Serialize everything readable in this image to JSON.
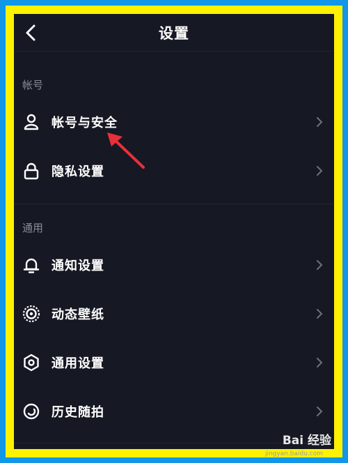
{
  "header": {
    "title": "设置"
  },
  "sections": [
    {
      "label": "帐号",
      "items": [
        {
          "label": "帐号与安全",
          "icon": "user-icon"
        },
        {
          "label": "隐私设置",
          "icon": "lock-icon"
        }
      ]
    },
    {
      "label": "通用",
      "items": [
        {
          "label": "通知设置",
          "icon": "bell-icon"
        },
        {
          "label": "动态壁纸",
          "icon": "wallpaper-icon"
        },
        {
          "label": "通用设置",
          "icon": "gear-icon"
        },
        {
          "label": "历史随拍",
          "icon": "history-icon"
        }
      ]
    }
  ],
  "watermark": {
    "text": "Bai 经验",
    "url": "jingyan.baidu.com"
  },
  "colors": {
    "background": "#161823",
    "frame": "#fff200",
    "outer": "#1296e8",
    "annotation": "#e8303a"
  }
}
